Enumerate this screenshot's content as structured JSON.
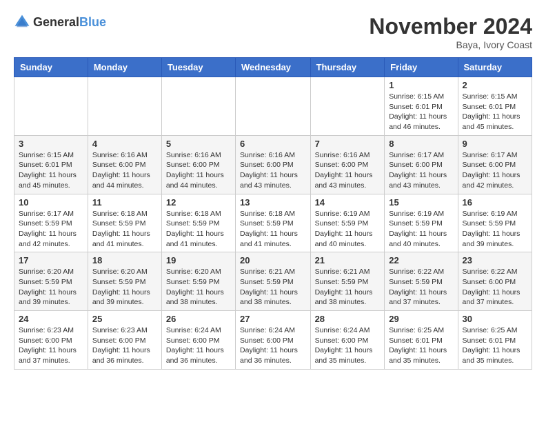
{
  "logo": {
    "general": "General",
    "blue": "Blue"
  },
  "title": "November 2024",
  "location": "Baya, Ivory Coast",
  "days_of_week": [
    "Sunday",
    "Monday",
    "Tuesday",
    "Wednesday",
    "Thursday",
    "Friday",
    "Saturday"
  ],
  "weeks": [
    [
      {
        "day": "",
        "info": ""
      },
      {
        "day": "",
        "info": ""
      },
      {
        "day": "",
        "info": ""
      },
      {
        "day": "",
        "info": ""
      },
      {
        "day": "",
        "info": ""
      },
      {
        "day": "1",
        "info": "Sunrise: 6:15 AM\nSunset: 6:01 PM\nDaylight: 11 hours and 46 minutes."
      },
      {
        "day": "2",
        "info": "Sunrise: 6:15 AM\nSunset: 6:01 PM\nDaylight: 11 hours and 45 minutes."
      }
    ],
    [
      {
        "day": "3",
        "info": "Sunrise: 6:15 AM\nSunset: 6:01 PM\nDaylight: 11 hours and 45 minutes."
      },
      {
        "day": "4",
        "info": "Sunrise: 6:16 AM\nSunset: 6:00 PM\nDaylight: 11 hours and 44 minutes."
      },
      {
        "day": "5",
        "info": "Sunrise: 6:16 AM\nSunset: 6:00 PM\nDaylight: 11 hours and 44 minutes."
      },
      {
        "day": "6",
        "info": "Sunrise: 6:16 AM\nSunset: 6:00 PM\nDaylight: 11 hours and 43 minutes."
      },
      {
        "day": "7",
        "info": "Sunrise: 6:16 AM\nSunset: 6:00 PM\nDaylight: 11 hours and 43 minutes."
      },
      {
        "day": "8",
        "info": "Sunrise: 6:17 AM\nSunset: 6:00 PM\nDaylight: 11 hours and 43 minutes."
      },
      {
        "day": "9",
        "info": "Sunrise: 6:17 AM\nSunset: 6:00 PM\nDaylight: 11 hours and 42 minutes."
      }
    ],
    [
      {
        "day": "10",
        "info": "Sunrise: 6:17 AM\nSunset: 5:59 PM\nDaylight: 11 hours and 42 minutes."
      },
      {
        "day": "11",
        "info": "Sunrise: 6:18 AM\nSunset: 5:59 PM\nDaylight: 11 hours and 41 minutes."
      },
      {
        "day": "12",
        "info": "Sunrise: 6:18 AM\nSunset: 5:59 PM\nDaylight: 11 hours and 41 minutes."
      },
      {
        "day": "13",
        "info": "Sunrise: 6:18 AM\nSunset: 5:59 PM\nDaylight: 11 hours and 41 minutes."
      },
      {
        "day": "14",
        "info": "Sunrise: 6:19 AM\nSunset: 5:59 PM\nDaylight: 11 hours and 40 minutes."
      },
      {
        "day": "15",
        "info": "Sunrise: 6:19 AM\nSunset: 5:59 PM\nDaylight: 11 hours and 40 minutes."
      },
      {
        "day": "16",
        "info": "Sunrise: 6:19 AM\nSunset: 5:59 PM\nDaylight: 11 hours and 39 minutes."
      }
    ],
    [
      {
        "day": "17",
        "info": "Sunrise: 6:20 AM\nSunset: 5:59 PM\nDaylight: 11 hours and 39 minutes."
      },
      {
        "day": "18",
        "info": "Sunrise: 6:20 AM\nSunset: 5:59 PM\nDaylight: 11 hours and 39 minutes."
      },
      {
        "day": "19",
        "info": "Sunrise: 6:20 AM\nSunset: 5:59 PM\nDaylight: 11 hours and 38 minutes."
      },
      {
        "day": "20",
        "info": "Sunrise: 6:21 AM\nSunset: 5:59 PM\nDaylight: 11 hours and 38 minutes."
      },
      {
        "day": "21",
        "info": "Sunrise: 6:21 AM\nSunset: 5:59 PM\nDaylight: 11 hours and 38 minutes."
      },
      {
        "day": "22",
        "info": "Sunrise: 6:22 AM\nSunset: 5:59 PM\nDaylight: 11 hours and 37 minutes."
      },
      {
        "day": "23",
        "info": "Sunrise: 6:22 AM\nSunset: 6:00 PM\nDaylight: 11 hours and 37 minutes."
      }
    ],
    [
      {
        "day": "24",
        "info": "Sunrise: 6:23 AM\nSunset: 6:00 PM\nDaylight: 11 hours and 37 minutes."
      },
      {
        "day": "25",
        "info": "Sunrise: 6:23 AM\nSunset: 6:00 PM\nDaylight: 11 hours and 36 minutes."
      },
      {
        "day": "26",
        "info": "Sunrise: 6:24 AM\nSunset: 6:00 PM\nDaylight: 11 hours and 36 minutes."
      },
      {
        "day": "27",
        "info": "Sunrise: 6:24 AM\nSunset: 6:00 PM\nDaylight: 11 hours and 36 minutes."
      },
      {
        "day": "28",
        "info": "Sunrise: 6:24 AM\nSunset: 6:00 PM\nDaylight: 11 hours and 35 minutes."
      },
      {
        "day": "29",
        "info": "Sunrise: 6:25 AM\nSunset: 6:01 PM\nDaylight: 11 hours and 35 minutes."
      },
      {
        "day": "30",
        "info": "Sunrise: 6:25 AM\nSunset: 6:01 PM\nDaylight: 11 hours and 35 minutes."
      }
    ]
  ]
}
